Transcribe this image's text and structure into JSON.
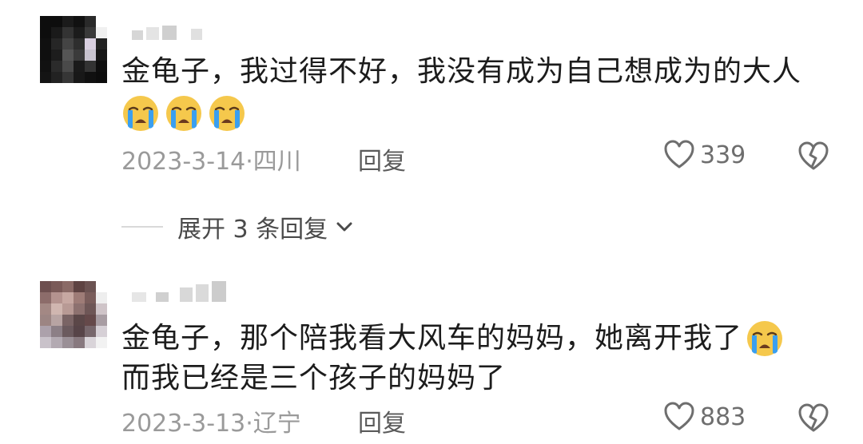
{
  "comments": [
    {
      "text_line1": "金龟子，我过得不好，我没有成为自己想成为的大人",
      "emoji_count_label": "",
      "date_location": "2023-3-14·四川",
      "reply_label": "回复",
      "likes": "339"
    },
    {
      "text_line1": "金龟子，那个陪我看大风车的妈妈，她离开我了",
      "text_line2": "而我已经是三个孩子的妈妈了",
      "date_location": "2023-3-13·辽宁",
      "reply_label": "回复",
      "likes": "883"
    }
  ],
  "expand_replies_label": "展开 3 条回复",
  "icons": {
    "emoji": "loudly-crying-face-emoji",
    "like": "heart-outline-icon",
    "dislike": "broken-heart-icon",
    "expand": "chevron-down-icon"
  },
  "colors": {
    "emoji_face": "#f5c84c",
    "emoji_tears": "#3a9ff0",
    "meta_text": "#9a9a9a",
    "icon_gray": "#6e6e6e"
  }
}
